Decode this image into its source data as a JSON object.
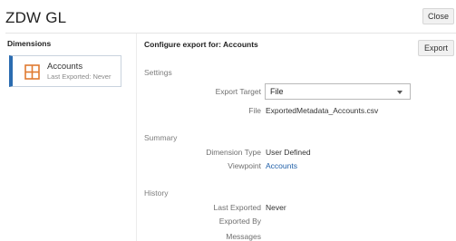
{
  "app": {
    "title": "ZDW GL"
  },
  "header": {
    "close_label": "Close",
    "export_label": "Export"
  },
  "sidebar": {
    "heading": "Dimensions",
    "card": {
      "name": "Accounts",
      "status": "Last Exported: Never",
      "icon": "grid-icon"
    }
  },
  "main": {
    "heading": "Configure export for: Accounts",
    "settings": {
      "title": "Settings",
      "export_target_label": "Export Target",
      "export_target_value": "File",
      "file_label": "File",
      "file_value": "ExportedMetadata_Accounts.csv"
    },
    "summary": {
      "title": "Summary",
      "dimension_type_label": "Dimension Type",
      "dimension_type_value": "User Defined",
      "viewpoint_label": "Viewpoint",
      "viewpoint_value": "Accounts"
    },
    "history": {
      "title": "History",
      "last_exported_label": "Last Exported",
      "last_exported_value": "Never",
      "exported_by_label": "Exported By",
      "messages_label": "Messages"
    }
  },
  "colors": {
    "accent": "#2b6cb0",
    "icon": "#e07a30",
    "link": "#1f5fa8"
  }
}
